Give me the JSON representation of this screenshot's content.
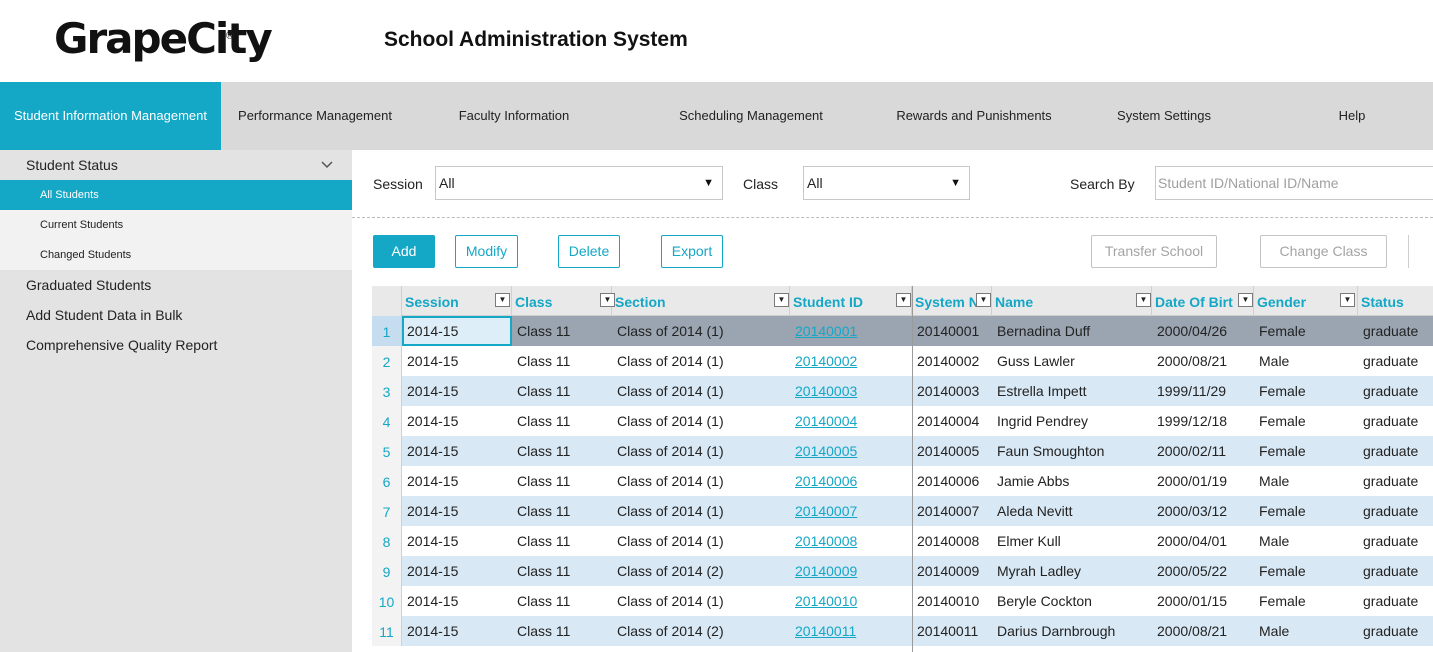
{
  "header": {
    "logo_text": "GrapeCity",
    "logo_mark": "®",
    "title": "School Administration System"
  },
  "nav": {
    "items": [
      {
        "label": "Student Information Management",
        "active": true
      },
      {
        "label": "Performance Management"
      },
      {
        "label": "Faculty Information"
      },
      {
        "label": "Scheduling Management"
      },
      {
        "label": "Rewards and Punishments"
      },
      {
        "label": "System Settings"
      },
      {
        "label": "Help"
      }
    ]
  },
  "sidebar": {
    "group_title": "Student Status",
    "chevron_icon": "chevron-down-icon",
    "sub_items": [
      {
        "label": "All Students",
        "active": true
      },
      {
        "label": "Current Students"
      },
      {
        "label": "Changed Students"
      }
    ],
    "items": [
      {
        "label": "Graduated Students"
      },
      {
        "label": "Add Student Data in Bulk"
      },
      {
        "label": "Comprehensive Quality Report"
      }
    ]
  },
  "filters": {
    "session_label": "Session",
    "session_value": "All",
    "class_label": "Class",
    "class_value": "All",
    "search_label": "Search By",
    "search_placeholder": "Student ID/National ID/Name"
  },
  "toolbar": {
    "add": "Add",
    "modify": "Modify",
    "delete": "Delete",
    "export": "Export",
    "transfer_school": "Transfer School",
    "change_class": "Change Class"
  },
  "grid": {
    "columns": [
      "Session",
      "Class",
      "Section",
      "Student ID",
      "System N",
      "Name",
      "Date Of Birt",
      "Gender",
      "Status"
    ],
    "filter_icon": "dropdown-filter-icon",
    "rows": [
      {
        "num": "1",
        "session": "2014-15",
        "class": "Class 11",
        "section": "Class of 2014 (1)",
        "student_id": "20140001",
        "system_no": "20140001",
        "name": "Bernadina Duff",
        "dob": "2000/04/26",
        "gender": "Female",
        "status": "graduate"
      },
      {
        "num": "2",
        "session": "2014-15",
        "class": "Class 11",
        "section": "Class of 2014 (1)",
        "student_id": "20140002",
        "system_no": "20140002",
        "name": "Guss Lawler",
        "dob": "2000/08/21",
        "gender": "Male",
        "status": "graduate"
      },
      {
        "num": "3",
        "session": "2014-15",
        "class": "Class 11",
        "section": "Class of 2014 (1)",
        "student_id": "20140003",
        "system_no": "20140003",
        "name": "Estrella Impett",
        "dob": "1999/11/29",
        "gender": "Female",
        "status": "graduate"
      },
      {
        "num": "4",
        "session": "2014-15",
        "class": "Class 11",
        "section": "Class of 2014 (1)",
        "student_id": "20140004",
        "system_no": "20140004",
        "name": "Ingrid Pendrey",
        "dob": "1999/12/18",
        "gender": "Female",
        "status": "graduate"
      },
      {
        "num": "5",
        "session": "2014-15",
        "class": "Class 11",
        "section": "Class of 2014 (1)",
        "student_id": "20140005",
        "system_no": "20140005",
        "name": "Faun Smoughton",
        "dob": "2000/02/11",
        "gender": "Female",
        "status": "graduate"
      },
      {
        "num": "6",
        "session": "2014-15",
        "class": "Class 11",
        "section": "Class of 2014 (1)",
        "student_id": "20140006",
        "system_no": "20140006",
        "name": "Jamie Abbs",
        "dob": "2000/01/19",
        "gender": "Male",
        "status": "graduate"
      },
      {
        "num": "7",
        "session": "2014-15",
        "class": "Class 11",
        "section": "Class of 2014 (1)",
        "student_id": "20140007",
        "system_no": "20140007",
        "name": "Aleda Nevitt",
        "dob": "2000/03/12",
        "gender": "Female",
        "status": "graduate"
      },
      {
        "num": "8",
        "session": "2014-15",
        "class": "Class 11",
        "section": "Class of 2014 (1)",
        "student_id": "20140008",
        "system_no": "20140008",
        "name": "Elmer Kull",
        "dob": "2000/04/01",
        "gender": "Male",
        "status": "graduate"
      },
      {
        "num": "9",
        "session": "2014-15",
        "class": "Class 11",
        "section": "Class of 2014 (2)",
        "student_id": "20140009",
        "system_no": "20140009",
        "name": "Myrah Ladley",
        "dob": "2000/05/22",
        "gender": "Female",
        "status": "graduate"
      },
      {
        "num": "10",
        "session": "2014-15",
        "class": "Class 11",
        "section": "Class of 2014 (1)",
        "student_id": "20140010",
        "system_no": "20140010",
        "name": "Beryle Cockton",
        "dob": "2000/01/15",
        "gender": "Female",
        "status": "graduate"
      },
      {
        "num": "11",
        "session": "2014-15",
        "class": "Class 11",
        "section": "Class of 2014 (2)",
        "student_id": "20140011",
        "system_no": "20140011",
        "name": "Darius Darnbrough",
        "dob": "2000/08/21",
        "gender": "Male",
        "status": "graduate"
      }
    ]
  },
  "colors": {
    "accent": "#14a7c6",
    "nav_bg": "#d9d9d9",
    "sidebar_bg": "#e3e3e3",
    "row_alt": "#d8e8f5",
    "row_selected": "#9aa5b1"
  }
}
